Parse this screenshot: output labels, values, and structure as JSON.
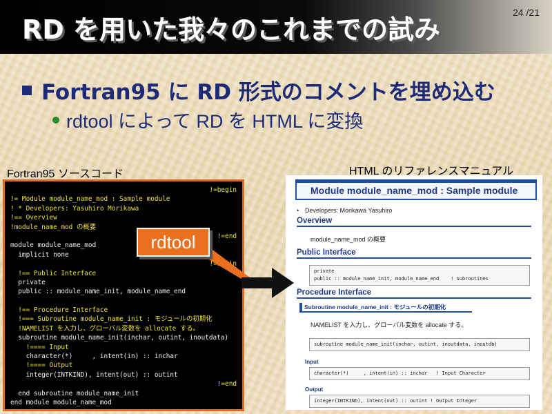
{
  "slide": {
    "title": "RD を用いた我々のこれまでの試み",
    "page_number": "24 /21"
  },
  "bullets": {
    "level1": "Fortran95 に RD 形式のコメントを埋め込む",
    "level2": "rdtool によって RD を HTML に変換"
  },
  "labels": {
    "source": "Fortran95 ソースコード",
    "reference": "HTML のリファレンスマニュアル",
    "tool": "rdtool"
  },
  "code_lines": [
    {
      "text": "!=begin",
      "color": "y",
      "align": "right"
    },
    {
      "text": "!= Module module_name_mod : Sample module",
      "color": "y"
    },
    {
      "text": "! * Developers: Yasuhiro Morikawa",
      "color": "y"
    },
    {
      "text": "!== Overview",
      "color": "y"
    },
    {
      "text": "!module_name_mod の概要",
      "color": "y"
    },
    {
      "text": "!=end",
      "color": "y",
      "align": "right"
    },
    {
      "text": "module module_name_mod",
      "color": "w"
    },
    {
      "text": "  implicit none",
      "color": "w"
    },
    {
      "text": "!=begin",
      "color": "y",
      "align": "right"
    },
    {
      "text": "  !== Public Interface",
      "color": "y"
    },
    {
      "text": "  private",
      "color": "w"
    },
    {
      "text": "  public :: module_name_init, module_name_end",
      "color": "w"
    },
    {
      "text": "",
      "color": "w"
    },
    {
      "text": "  !== Procedure Interface",
      "color": "y"
    },
    {
      "text": "  !=== Subroutine module_name_init : モジュールの初期化",
      "color": "y"
    },
    {
      "text": "  !NAMELIST を入力し、グローバル変数を allocate する。",
      "color": "y"
    },
    {
      "text": "  subroutine module_name_init(inchar, outint, inoutdata)",
      "color": "w"
    },
    {
      "text": "    !==== Input",
      "color": "y"
    },
    {
      "text": "    character(*)     , intent(in) :: inchar",
      "color": "w"
    },
    {
      "text": "    !==== Output",
      "color": "y"
    },
    {
      "text": "    integer(INTKIND), intent(out) :: outint",
      "color": "w"
    },
    {
      "text": "!=end",
      "color": "y",
      "align": "right"
    },
    {
      "text": "  end subroutine module_name_init",
      "color": "w"
    },
    {
      "text": "end module module_name_mod",
      "color": "w"
    }
  ],
  "reference": {
    "title": "Module module_name_mod : Sample module",
    "developers": "Developers: Morikawa Yasuhiro",
    "overview_heading": "Overview",
    "overview_text": "module_name_mod の概要",
    "public_heading": "Public Interface",
    "public_code": "private\npublic :: module_name_init, module_name_end    ! subroutines",
    "procedure_heading": "Procedure Interface",
    "subroutine_heading": "Subroutine module_name_init : モジュールの初期化",
    "subroutine_text": "NAMELIST を入力し、グローバル変数を allocate する。",
    "subroutine_code": "subroutine module_name_init(inchar, outint, inoutdata, inoutdb)",
    "input_heading": "Input",
    "input_code": "character(*)     , intent(in) :: inchar   ! Input Character",
    "output_heading": "Output",
    "output_code": "integer(INTKIND), intent(out) :: outint ! Output Integer"
  },
  "colors": {
    "title_text": "#ffffff",
    "heading_blue": "#1c2a78",
    "tool_orange": "#e8701e",
    "code_yellow": "#f2e23a"
  }
}
